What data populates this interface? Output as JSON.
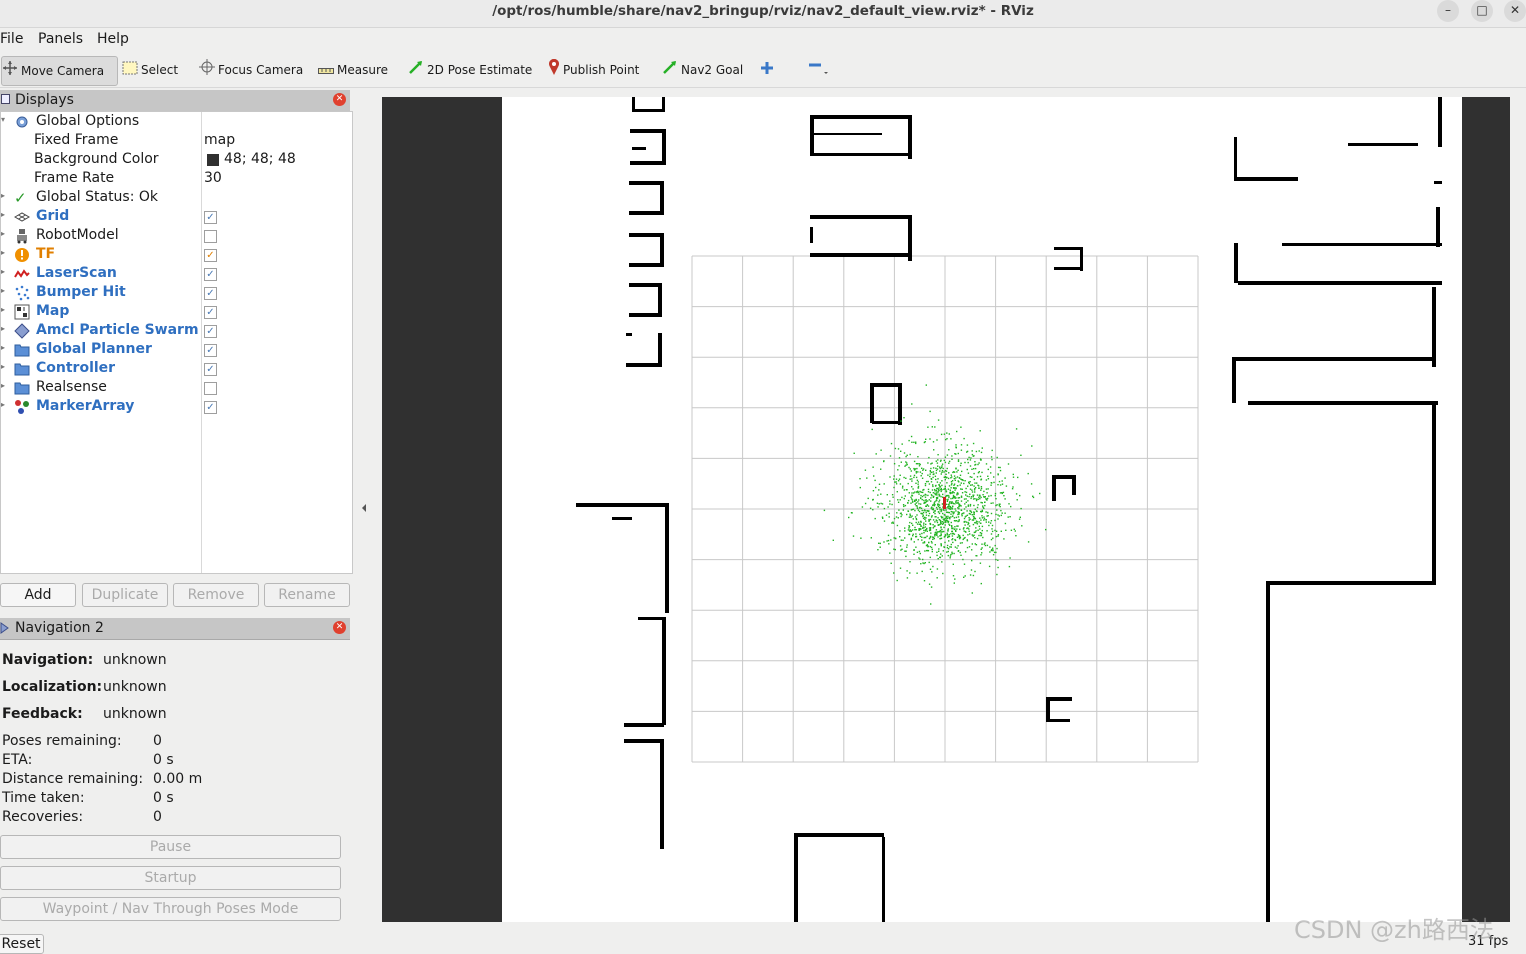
{
  "window": {
    "title": "/opt/ros/humble/share/nav2_bringup/rviz/nav2_default_view.rviz* - RViz",
    "minimize": "–",
    "maximize": "□",
    "close": "✕"
  },
  "menu": [
    "File",
    "Panels",
    "Help"
  ],
  "toolbar": {
    "move_camera": "Move Camera",
    "select": "Select",
    "focus_camera": "Focus Camera",
    "measure": "Measure",
    "pose_estimate": "2D Pose Estimate",
    "publish_point": "Publish Point",
    "nav2_goal": "Nav2 Goal"
  },
  "displays": {
    "header": "Displays",
    "global_options": "Global Options",
    "fixed_frame_label": "Fixed Frame",
    "fixed_frame_value": "map",
    "background_color_label": "Background Color",
    "background_color_value": "48; 48; 48",
    "frame_rate_label": "Frame Rate",
    "frame_rate_value": "30",
    "global_status": "Global Status: Ok",
    "items": [
      {
        "label": "Grid",
        "checked": true,
        "style": "blue"
      },
      {
        "label": "RobotModel",
        "checked": false,
        "style": "plain"
      },
      {
        "label": "TF",
        "checked": true,
        "style": "orange"
      },
      {
        "label": "LaserScan",
        "checked": true,
        "style": "blue"
      },
      {
        "label": "Bumper Hit",
        "checked": true,
        "style": "blue"
      },
      {
        "label": "Map",
        "checked": true,
        "style": "blue"
      },
      {
        "label": "Amcl Particle Swarm",
        "checked": true,
        "style": "blue"
      },
      {
        "label": "Global Planner",
        "checked": true,
        "style": "blue"
      },
      {
        "label": "Controller",
        "checked": true,
        "style": "blue"
      },
      {
        "label": "Realsense",
        "checked": false,
        "style": "plain"
      },
      {
        "label": "MarkerArray",
        "checked": true,
        "style": "blue"
      }
    ],
    "buttons": {
      "add": "Add",
      "duplicate": "Duplicate",
      "remove": "Remove",
      "rename": "Rename"
    }
  },
  "nav2": {
    "header": "Navigation 2",
    "navigation_label": "Navigation:",
    "navigation_value": "unknown",
    "localization_label": "Localization:",
    "localization_value": "unknown",
    "feedback_label": "Feedback:",
    "feedback_value": "unknown",
    "poses_label": "Poses remaining:",
    "poses_value": "0",
    "eta_label": "ETA:",
    "eta_value": "0 s",
    "distance_label": "Distance remaining:",
    "distance_value": "0.00 m",
    "time_label": "Time taken:",
    "time_value": "0 s",
    "recoveries_label": "Recoveries:",
    "recoveries_value": "0",
    "pause": "Pause",
    "startup": "Startup",
    "waypoint": "Waypoint / Nav Through Poses Mode"
  },
  "status": {
    "reset": "Reset",
    "fps": "31 fps",
    "watermark": "CSDN @zh路西法"
  },
  "colors": {
    "viewport_bg": "#303030",
    "grid_line": "#c8c8c8",
    "particles": "#22b422",
    "link_blue": "#2f6fc0",
    "tf_orange": "#e07f00"
  }
}
